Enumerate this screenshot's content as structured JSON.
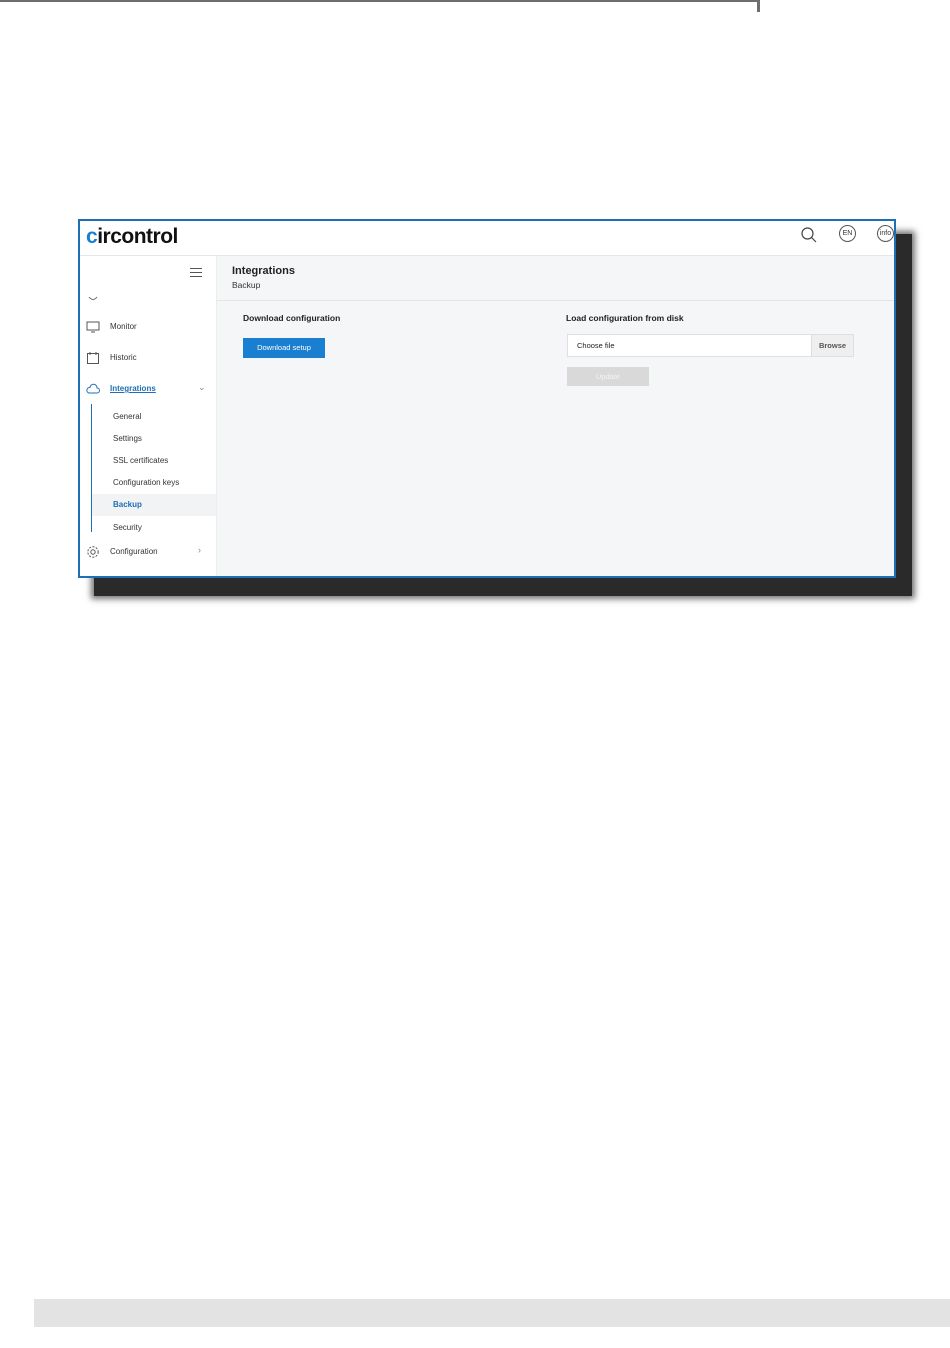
{
  "brand": {
    "logo_text": "ircontrol",
    "logo_mark": "c"
  },
  "header": {
    "language": "EN",
    "info": "info"
  },
  "sidebar": {
    "items": [
      {
        "label": "Monitor"
      },
      {
        "label": "Historic"
      },
      {
        "label": "Integrations"
      }
    ],
    "sub_items": [
      {
        "label": "General"
      },
      {
        "label": "Settings"
      },
      {
        "label": "SSL certificates"
      },
      {
        "label": "Configuration keys"
      },
      {
        "label": "Backup"
      },
      {
        "label": "Security"
      }
    ],
    "configuration": {
      "label": "Configuration"
    }
  },
  "page": {
    "title": "Integrations",
    "subtitle": "Backup"
  },
  "download": {
    "title": "Download configuration",
    "button": "Download setup"
  },
  "load": {
    "title": "Load configuration from disk",
    "file_placeholder": "Choose file",
    "browse": "Browse",
    "update": "Update"
  },
  "colors": {
    "accent": "#1a7fd0",
    "frame": "#1f6fb5"
  }
}
